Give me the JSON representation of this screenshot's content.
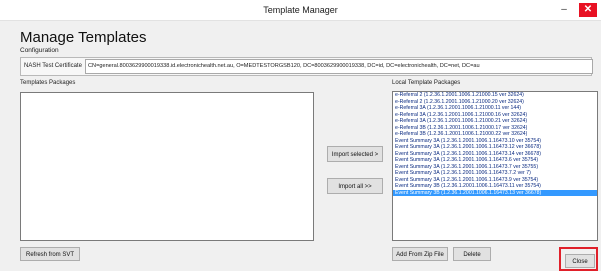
{
  "window": {
    "title": "Template Manager",
    "minimize_glyph": "–",
    "close_glyph": "✕"
  },
  "header": {
    "title": "Manage Templates",
    "subtitle": "Configuration"
  },
  "certificate": {
    "label": "NASH Test Certificate",
    "value": "CN=general.8003629900019338.id.electronichealth.net.au, O=MEDTESTORGSB120, DC=8003629900019338, DC=id, DC=electronichealth, DC=net, DC=au"
  },
  "templates_packages": {
    "label": "Templates Packages",
    "items": []
  },
  "local_template_packages": {
    "label": "Local Template Packages",
    "items": [
      "e-Referral 2  (1.2.36.1.2001.1006.1.21000.15 ver 32624)",
      "e-Referral 2  (1.2.36.1.2001.1006.1.21000.20 ver 32624)",
      "e-Referral 3A  (1.2.36.1.2001.1006.1.21000.11 ver 144)",
      "e-Referral 3A  (1.2.36.1.2001.1006.1.21000.16 ver 32624)",
      "e-Referral 3A  (1.2.36.1.2001.1006.1.21000.21 ver 32624)",
      "e-Referral 3B  (1.2.36.1.2001.1006.1.21000.17 ver 32624)",
      "e-Referral 3B  (1.2.36.1.2001.1006.1.21000.22 ver 32624)",
      "Event Summary 3A  (1.2.36.1.2001.1006.1.16473.10 ver 35754)",
      "Event Summary 3A  (1.2.36.1.2001.1006.1.16473.12 ver 36678)",
      "Event Summary 3A  (1.2.36.1.2001.1006.1.16473.14 ver 36678)",
      "Event Summary 3A  (1.2.36.1.2001.1006.1.16473.6 ver 35754)",
      "Event Summary 3A  (1.2.36.1.2001.1006.1.16473.7 ver 35755)",
      "Event Summary 3A  (1.2.36.1.2001.1006.1.16473.7.2 ver 7)",
      "Event Summary 3A  (1.2.36.1.2001.1006.1.16473.9 ver 35754)",
      "Event Summary 3B  (1.2.36.1.2001.1006.1.16473.11 ver 35754)",
      "Event Summary 3B  (1.2.36.1.2001.1006.1.16473.13 ver 36678)"
    ],
    "selected_index": 15
  },
  "buttons": {
    "import_selected": "Import selected >",
    "import_all": "Import all >>",
    "refresh": "Refresh from SVT",
    "add_from_zip": "Add From Zip File",
    "delete": "Delete",
    "close": "Close"
  },
  "colors": {
    "selection": "#3399ff",
    "highlight_box": "#e0202a"
  }
}
